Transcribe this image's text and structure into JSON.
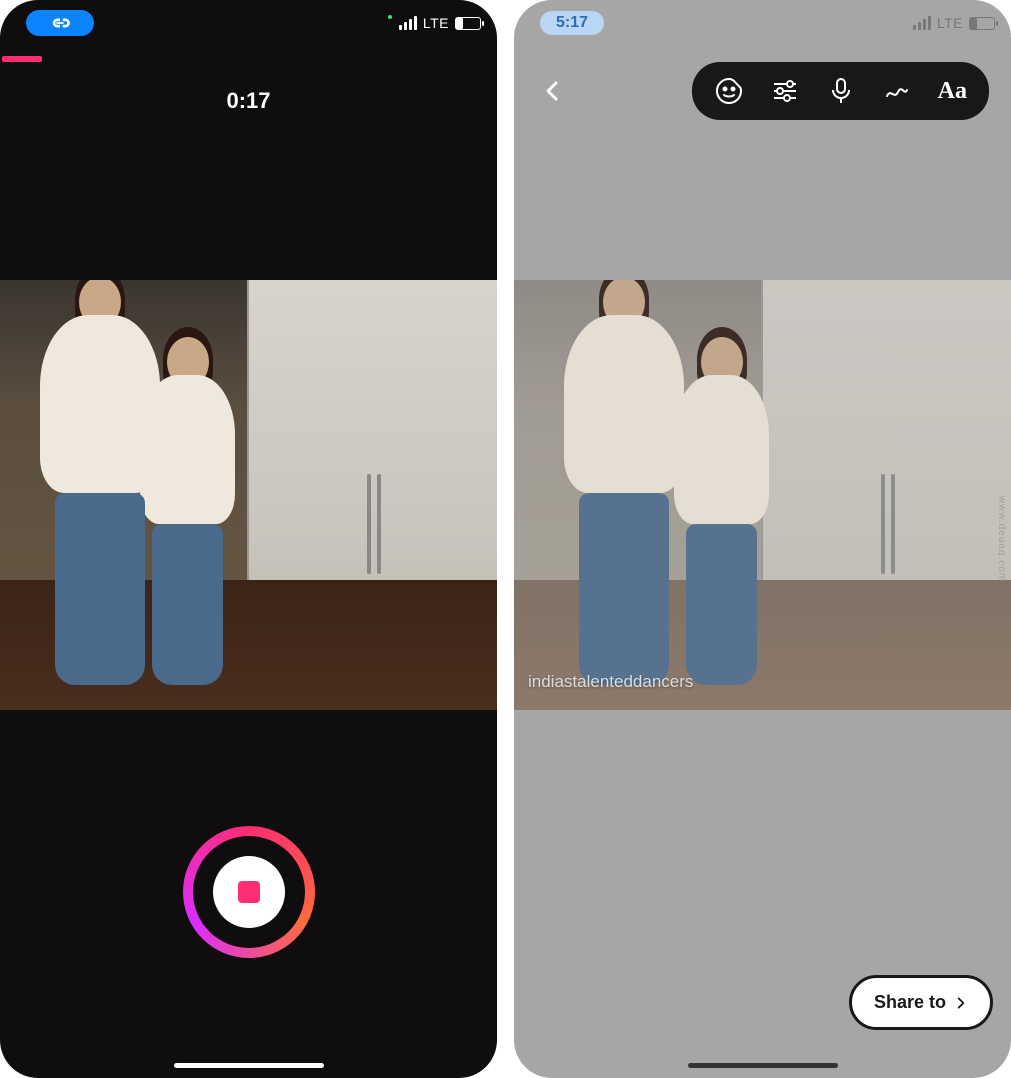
{
  "left": {
    "status": {
      "network": "LTE"
    },
    "timer": "0:17"
  },
  "right": {
    "status": {
      "time": "5:17",
      "network": "LTE"
    },
    "tools": {
      "sticker": "sticker-icon",
      "adjust": "adjust-icon",
      "mic": "mic-icon",
      "draw": "draw-icon",
      "text_label": "Aa"
    },
    "caption": "indiastalenteddancers",
    "share_label": "Share to"
  },
  "watermark": "www.deuaq.com"
}
